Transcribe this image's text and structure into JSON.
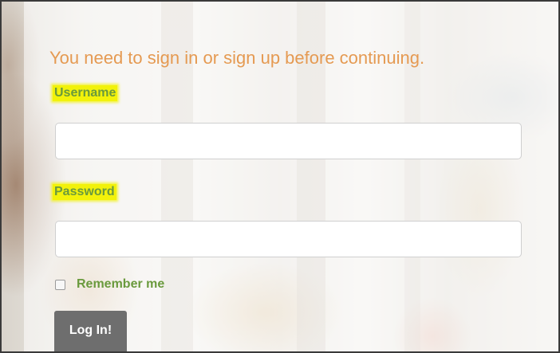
{
  "notice": "You need to sign in or sign up before continuing.",
  "username": {
    "label": "Username",
    "value": "",
    "placeholder": ""
  },
  "password": {
    "label": "Password",
    "value": "",
    "placeholder": ""
  },
  "remember": {
    "label": "Remember me",
    "checked": false
  },
  "login_button": "Log In!",
  "colors": {
    "notice": "#e59a52",
    "label": "#6a9a3d",
    "highlight": "#f2f20a",
    "button": "#6e6e6e"
  }
}
